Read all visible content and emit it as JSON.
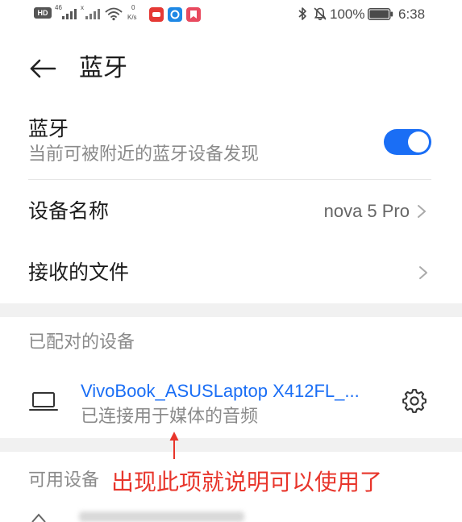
{
  "status_bar": {
    "hd_badge": "HD",
    "network_type": "46",
    "secondary_network": "x",
    "speed_value": "0",
    "speed_unit": "K/s",
    "battery_level": "100%",
    "time": "6:38",
    "icons": [
      "signal-icon",
      "wifi-icon",
      "bluetooth-icon",
      "mute-bell-icon",
      "battery-icon"
    ]
  },
  "header": {
    "back_icon": "back-arrow-icon",
    "title": "蓝牙"
  },
  "bluetooth": {
    "label": "蓝牙",
    "description": "当前可被附近的蓝牙设备发现",
    "enabled": true
  },
  "settings": {
    "device_name_label": "设备名称",
    "device_name_value": "nova 5 Pro",
    "received_files_label": "接收的文件",
    "chevron_icon": "chevron-right-icon"
  },
  "paired": {
    "section_title": "已配对的设备",
    "devices": [
      {
        "icon": "laptop-icon",
        "name": "VivoBook_ASUSLaptop X412FL_...",
        "status": "已连接用于媒体的音频",
        "settings_icon": "gear-icon"
      }
    ]
  },
  "available": {
    "section_title": "可用设备"
  },
  "annotation": {
    "text": "出现此项就说明可以使用了",
    "arrow_icon": "arrow-up-icon"
  },
  "colors": {
    "accent": "#1a6ef5",
    "annotation": "#e8352b",
    "text_primary": "#1b1b1b",
    "text_secondary": "#8a8a8a",
    "section_band": "#f1f1f1"
  }
}
